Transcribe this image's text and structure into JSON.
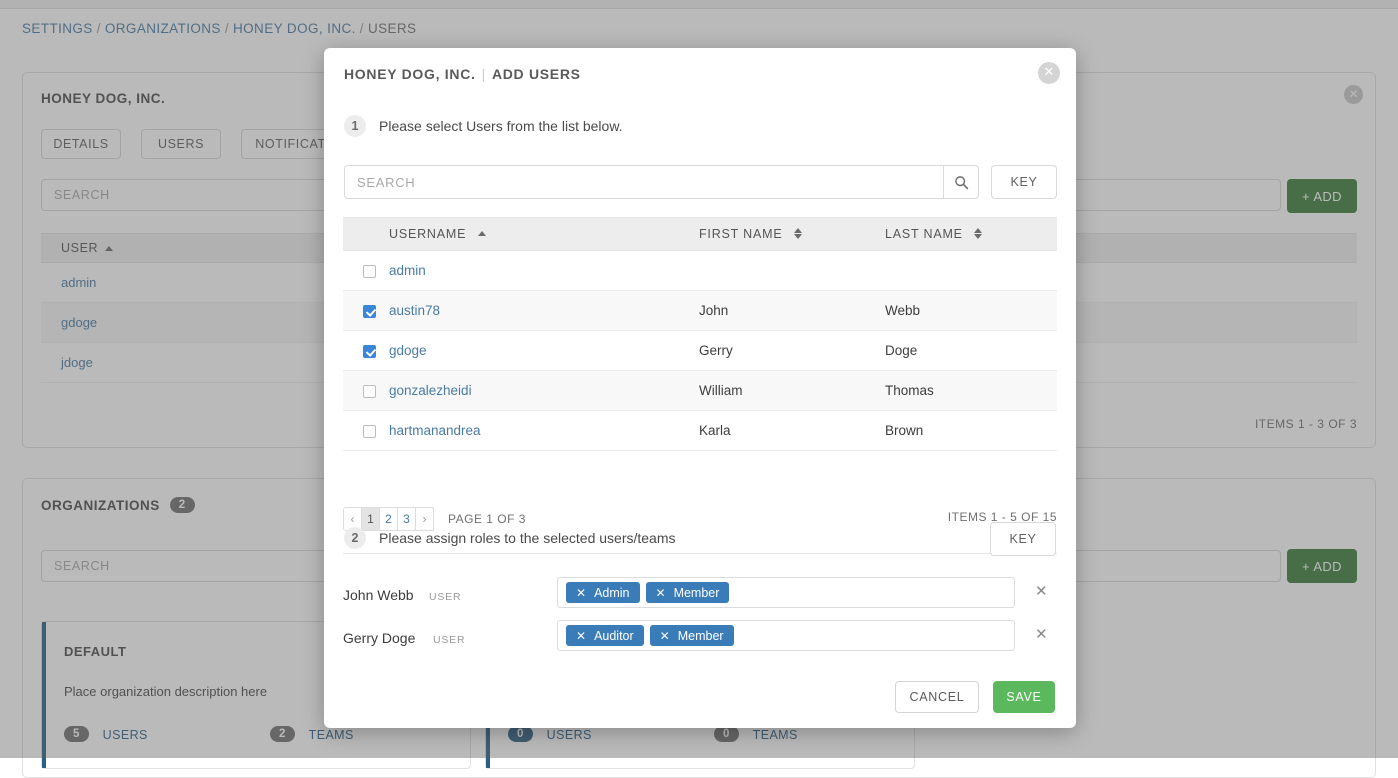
{
  "breadcrumb": {
    "items": [
      {
        "label": "SETTINGS",
        "link": true
      },
      {
        "label": "ORGANIZATIONS",
        "link": true
      },
      {
        "label": "HONEY DOG, INC.",
        "link": true
      },
      {
        "label": "USERS",
        "link": false
      }
    ],
    "separator": "/"
  },
  "background": {
    "users_card": {
      "title": "HONEY DOG, INC.",
      "tabs": [
        "DETAILS",
        "USERS",
        "NOTIFICATIONS"
      ],
      "search_placeholder": "SEARCH",
      "add_label": "+ ADD",
      "close_icon": "close-icon",
      "column_header": "USER",
      "rows": [
        "admin",
        "gdoge",
        "jdoge"
      ],
      "items_count": "ITEMS  1 - 3 OF 3"
    },
    "orgs_card": {
      "title": "ORGANIZATIONS",
      "badge": "2",
      "search_placeholder": "SEARCH",
      "add_label": "+ ADD",
      "org1": {
        "name": "DEFAULT",
        "description": "Place organization description here",
        "users_count": "5",
        "users_label": "USERS",
        "teams_count": "2",
        "teams_label": "TEAMS"
      },
      "org2": {
        "users_count": "0",
        "users_label": "USERS",
        "teams_count": "0",
        "teams_label": "TEAMS"
      }
    }
  },
  "modal": {
    "org_title": "HONEY DOG, INC.",
    "divider": "|",
    "action_title": "ADD USERS",
    "close_icon": "close-icon",
    "step1": {
      "number": "1",
      "text": "Please select Users from the list below.",
      "search_placeholder": "SEARCH",
      "search_icon": "search-icon",
      "key_label": "KEY"
    },
    "table": {
      "headers": [
        "USERNAME",
        "FIRST NAME",
        "LAST NAME"
      ],
      "sort": {
        "username": "asc",
        "first_name": "none",
        "last_name": "none"
      },
      "rows": [
        {
          "checked": false,
          "username": "admin",
          "first_name": "",
          "last_name": ""
        },
        {
          "checked": true,
          "username": "austin78",
          "first_name": "John",
          "last_name": "Webb"
        },
        {
          "checked": true,
          "username": "gdoge",
          "first_name": "Gerry",
          "last_name": "Doge"
        },
        {
          "checked": false,
          "username": "gonzalezheidi",
          "first_name": "William",
          "last_name": "Thomas"
        },
        {
          "checked": false,
          "username": "hartmanandrea",
          "first_name": "Karla",
          "last_name": "Brown"
        }
      ]
    },
    "pagination": {
      "prev_icon": "chevron-left-icon",
      "next_icon": "chevron-right-icon",
      "pages": [
        "1",
        "2",
        "3"
      ],
      "active_page": "1",
      "page_label": "PAGE 1 OF 3",
      "items_label": "ITEMS  1 - 5 OF 15"
    },
    "step2": {
      "number": "2",
      "text": "Please assign roles to the selected users/teams",
      "key_label": "KEY"
    },
    "assignments": [
      {
        "name": "John Webb",
        "type": "USER",
        "tags": [
          "Admin",
          "Member"
        ],
        "remove_icon": "remove-icon"
      },
      {
        "name": "Gerry Doge",
        "type": "USER",
        "tags": [
          "Auditor",
          "Member"
        ],
        "remove_icon": "remove-icon"
      }
    ],
    "footer": {
      "cancel_label": "CANCEL",
      "save_label": "SAVE"
    }
  },
  "colors": {
    "accent_blue": "#3a7cb8",
    "link_blue": "#4a7ba5",
    "save_green": "#5cb85c",
    "add_green": "#3a7d3a",
    "checkbox_blue": "#3b86d6"
  }
}
